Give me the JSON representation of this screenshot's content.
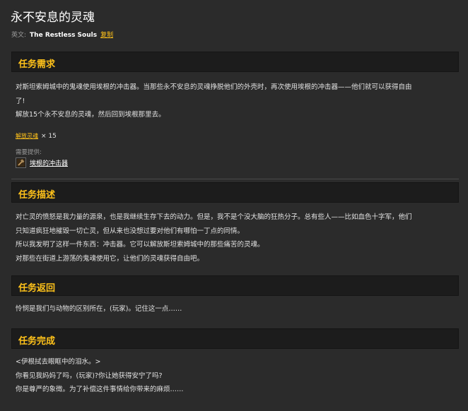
{
  "quest": {
    "title": "永不安息的灵魂",
    "english_label": "英文:",
    "english_name": "The Restless Souls",
    "copy_label": "复制"
  },
  "sections": {
    "requirements": {
      "heading": "任务需求",
      "lines": [
        "对斯坦索姆城中的鬼魂使用埃根的冲击器。当那些永不安息的灵魂挣脱他们的外壳时，再次使用埃根的冲击器——他们就可以获得自由",
        "了!",
        "解放15个永不安息的灵魂，然后回到埃根那里去。"
      ],
      "objective_link": "解放灵魂",
      "objective_count": "× 15",
      "provided_label": "需要提供:",
      "provided_item": "埃根的冲击器"
    },
    "description": {
      "heading": "任务描述",
      "lines": [
        "对亡灵的愤怒是我力量的源泉，也是我继续生存下去的动力。但是，我不是个没大脑的狂热分子。总有些人——比如血色十字军，他们",
        "只知道疯狂地摧毁一切亡灵，但从来也没想过要对他们有哪怕一丁点的同情。",
        "所以我发明了这样一件东西：冲击器。它可以解放斯坦索姆城中的那些痛苦的灵魂。",
        "对那些在街道上游荡的鬼魂使用它，让他们的灵魂获得自由吧。"
      ]
    },
    "progress": {
      "heading": "任务返回",
      "lines": [
        "怜悯是我们与动物的区别所在，(玩家)。记住这一点……"
      ]
    },
    "completion": {
      "heading": "任务完成",
      "lines": [
        "<伊根拭去眼眶中的泪水。>",
        "你看见我妈妈了吗，(玩家)?你让她获得安宁了吗?",
        "你是尊严的象徵。为了补偿这件事情给你带来的麻烦……"
      ]
    }
  },
  "colors": {
    "accent": "#ffc21a",
    "background": "#2b2b2b",
    "header_bg": "#1c1c1c"
  },
  "icons": {
    "provided_item": "hammer-icon"
  }
}
